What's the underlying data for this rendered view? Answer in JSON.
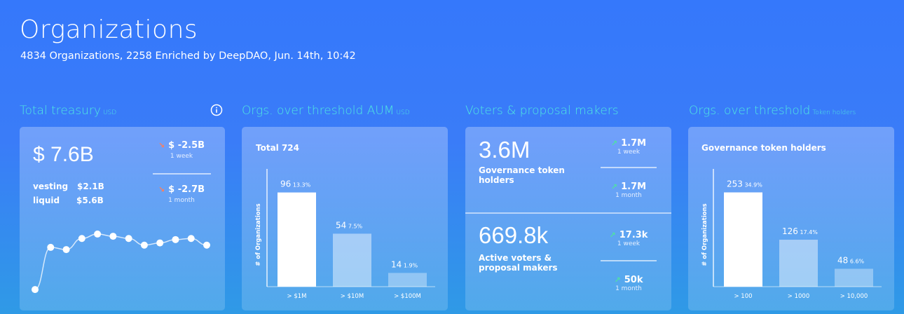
{
  "header": {
    "title": "Organizations",
    "subtitle": "4834 Organizations, 2258 Enriched by DeepDAO, Jun. 14th, 10:42"
  },
  "sections": {
    "treasury": {
      "title": "Total treasury",
      "unit": "USD"
    },
    "aum": {
      "title": "Orgs. over threshold AUM",
      "unit": "USD"
    },
    "voters": {
      "title": "Voters & proposal makers"
    },
    "holders": {
      "title": "Orgs. over threshold",
      "unit": "Token holders"
    }
  },
  "treasury_card": {
    "total": "$ 7.6B",
    "vesting_label": "vesting",
    "vesting_value": "$2.1B",
    "liquid_label": "liquid",
    "liquid_value": "$5.6B",
    "week_change": "$ -2.5B",
    "week_label": "1 week",
    "month_change": "$ -2.7B",
    "month_label": "1 month"
  },
  "voters_card": {
    "top_value": "3.6M",
    "top_label_line1": "Governance token",
    "top_label_line2": "holders",
    "top_week_change": "1.7M",
    "top_week_label": "1 week",
    "top_month_change": "1.7M",
    "top_month_label": "1 month",
    "bottom_value": "669.8k",
    "bottom_label_line1": "Active voters &",
    "bottom_label_line2": "proposal makers",
    "bottom_week_change": "17.3k",
    "bottom_week_label": "1 week",
    "bottom_month_change": "50k",
    "bottom_month_label": "1 month"
  },
  "colors": {
    "accent_title": "#4fe8e0",
    "down_arrow": "#ff7e5a",
    "up_arrow": "#4fe0a4"
  },
  "chart_data": [
    {
      "id": "treasury-trend",
      "type": "line",
      "values": [
        2,
        5.8,
        5.6,
        6.6,
        7.0,
        6.8,
        6.6,
        6.0,
        6.2,
        6.5,
        6.6,
        6.0
      ],
      "ylim": [
        1.5,
        7.5
      ]
    },
    {
      "id": "aum",
      "type": "bar",
      "title": "Total 724",
      "ylabel": "# of Organizations",
      "categories": [
        "> $1M",
        "> $10M",
        "> $100M"
      ],
      "values": [
        96,
        54,
        14
      ],
      "percents": [
        "13.3%",
        "7.5%",
        "1.9%"
      ],
      "ylim": [
        0,
        120
      ]
    },
    {
      "id": "holders",
      "type": "bar",
      "title": "Governance token holders",
      "ylabel": "# of Organizations",
      "categories": [
        "> 100",
        "> 1000",
        "> 10,000"
      ],
      "values": [
        253,
        126,
        48
      ],
      "percents": [
        "34.9%",
        "17.4%",
        "6.6%"
      ],
      "ylim": [
        0,
        316
      ]
    }
  ]
}
